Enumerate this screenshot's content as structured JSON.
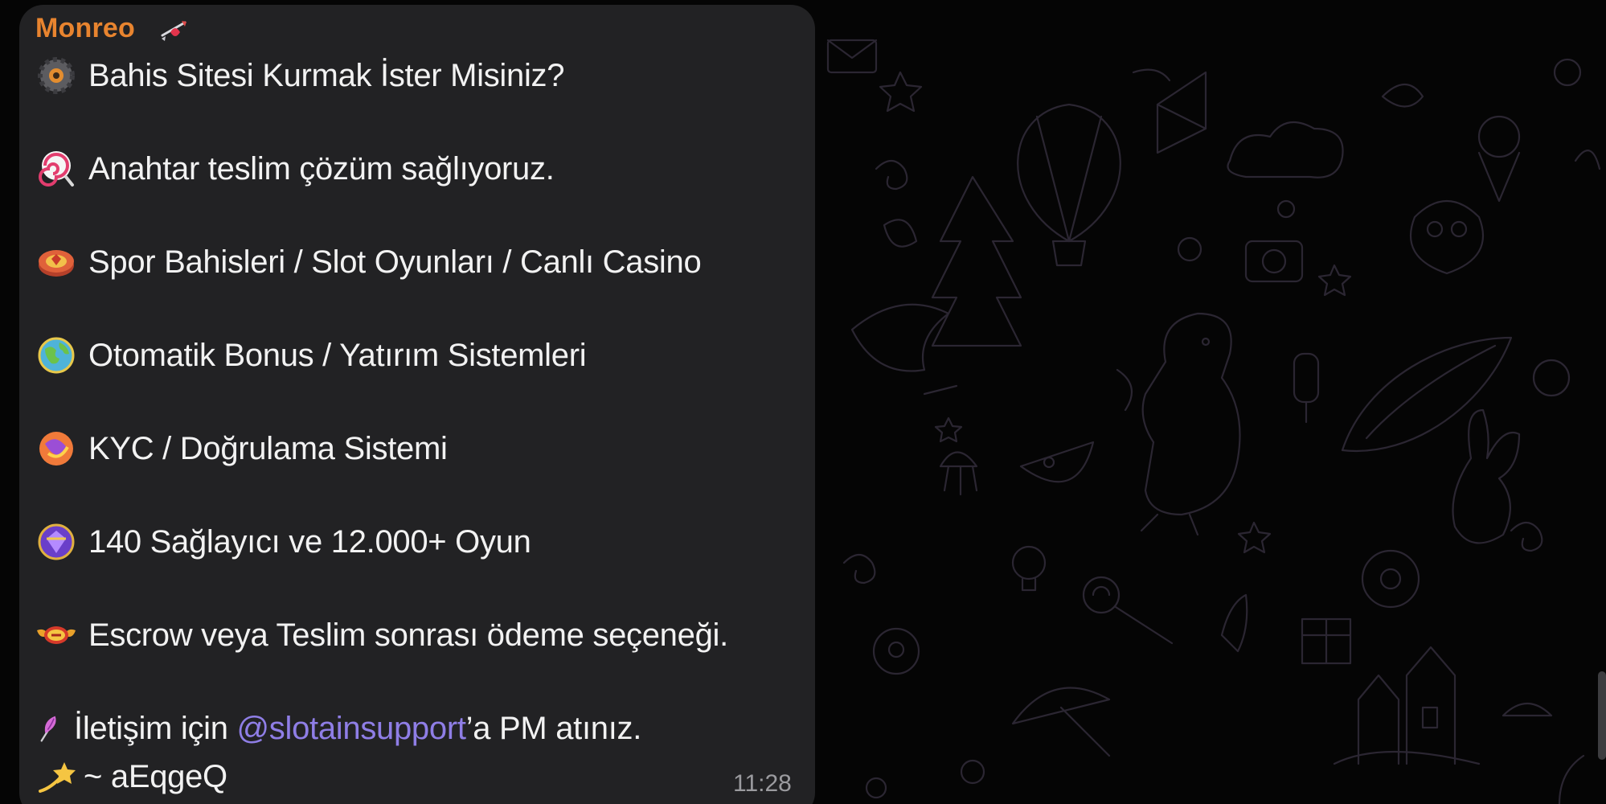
{
  "chat": {
    "sender_name": "Monreo",
    "sender_badge_icon": "cupid-arrow-badge-icon",
    "sender_color": "#e8842f",
    "message": {
      "lines": [
        {
          "icon": "gear-coin-icon",
          "text": "Bahis Sitesi Kurmak İster Misiniz?"
        },
        {
          "icon": "lollipop-icon",
          "text": "Anahtar teslim çözüm sağlıyoruz."
        },
        {
          "icon": "casino-chip-icon",
          "text": "Spor Bahisleri / Slot Oyunları / Canlı Casino"
        },
        {
          "icon": "globe-icon",
          "text": "Otomatik Bonus / Yatırım Sistemleri"
        },
        {
          "icon": "swirl-badge-icon",
          "text": "KYC / Doğrulama Sistemi"
        },
        {
          "icon": "purple-gem-icon",
          "text": "140 Sağlayıcı ve 12.000+ Oyun"
        },
        {
          "icon": "gold-wings-badge-icon",
          "text": "Escrow veya Teslim sonrası ödeme seçeneği."
        }
      ],
      "contact": {
        "icon": "feather-quill-icon",
        "prefix": "İletişim için ",
        "mention": "@slotainsupport",
        "suffix": "’a PM atınız.",
        "mention_color": "#8f7ee6"
      },
      "signature": {
        "icon": "dizzy-star-icon",
        "text": "~ aEqgeQ"
      },
      "time": "11:28"
    }
  },
  "colors": {
    "wallpaper": "#050505",
    "doodle": "#2a2530",
    "bubble": "#222224",
    "text": "#f2f2f2",
    "time": "#9b9b9f"
  }
}
